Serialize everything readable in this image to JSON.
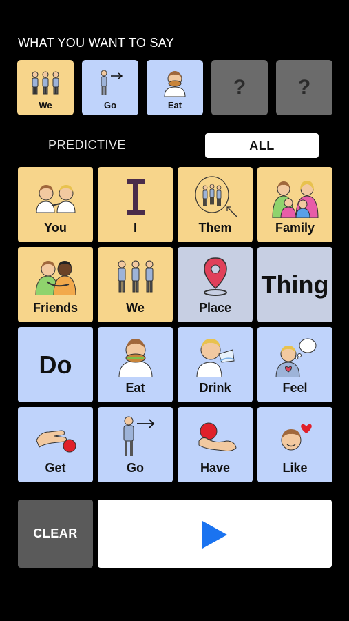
{
  "heading": "WHAT YOU WANT TO SAY",
  "sentence": [
    {
      "label": "We",
      "icon": "three-people-icon",
      "color": "#f7d58b"
    },
    {
      "label": "Go",
      "icon": "person-walking-arrow-icon",
      "color": "#bfd3fb"
    },
    {
      "label": "Eat",
      "icon": "person-eating-icon",
      "color": "#bfd3fb"
    },
    {
      "label": "?",
      "icon": "empty-slot",
      "color": "#6b6b6b"
    },
    {
      "label": "?",
      "icon": "empty-slot",
      "color": "#6b6b6b"
    }
  ],
  "tabs": {
    "predictive": "PREDICTIVE",
    "all": "ALL",
    "selected": "all"
  },
  "grid": [
    {
      "label": "You",
      "icon": "two-people-pointing-icon",
      "color": "#f7d58b"
    },
    {
      "label": "I",
      "icon": "letter-i-icon",
      "color": "#f7d58b"
    },
    {
      "label": "Them",
      "icon": "circled-group-icon",
      "color": "#f7d58b"
    },
    {
      "label": "Family",
      "icon": "family-icon",
      "color": "#f7d58b"
    },
    {
      "label": "Friends",
      "icon": "friends-hug-icon",
      "color": "#f7d58b"
    },
    {
      "label": "We",
      "icon": "three-people-icon",
      "color": "#f7d58b"
    },
    {
      "label": "Place",
      "icon": "map-pin-icon",
      "color": "#c7cfe3"
    },
    {
      "label": "Thing",
      "icon": "",
      "color": "#c7cfe3"
    },
    {
      "label": "Do",
      "icon": "",
      "color": "#bfd3fb"
    },
    {
      "label": "Eat",
      "icon": "person-eating-icon",
      "color": "#bfd3fb"
    },
    {
      "label": "Drink",
      "icon": "person-drinking-icon",
      "color": "#bfd3fb"
    },
    {
      "label": "Feel",
      "icon": "person-thinking-heart-icon",
      "color": "#bfd3fb"
    },
    {
      "label": "Get",
      "icon": "hand-reaching-ball-icon",
      "color": "#bfd3fb"
    },
    {
      "label": "Go",
      "icon": "person-walking-arrow-icon",
      "color": "#bfd3fb"
    },
    {
      "label": "Have",
      "icon": "hand-holding-ball-icon",
      "color": "#bfd3fb"
    },
    {
      "label": "Like",
      "icon": "face-heart-icon",
      "color": "#bfd3fb"
    }
  ],
  "footer": {
    "clear_label": "CLEAR",
    "play_icon": "play-icon",
    "play_color": "#1a73f0"
  }
}
